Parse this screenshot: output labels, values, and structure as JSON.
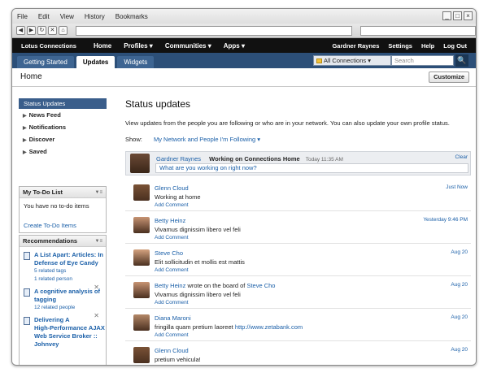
{
  "browser": {
    "menu": [
      "File",
      "Edit",
      "View",
      "History",
      "Bookmarks"
    ],
    "window_buttons": [
      "_",
      "□",
      "×"
    ],
    "nav_glyphs": [
      "◀",
      "▶",
      "↻",
      "✕",
      "⌂"
    ]
  },
  "topbar": {
    "logo": "Lotus Connections",
    "nav": [
      "Home",
      "Profiles ▾",
      "Communities ▾",
      "Apps ▾"
    ],
    "right": [
      "Gardner Raynes",
      "Settings",
      "Help",
      "Log Out"
    ]
  },
  "tabs": [
    "Getting Started",
    "Updates",
    "Widgets"
  ],
  "search": {
    "scope": "All Connections ▾",
    "placeholder": "Search",
    "button": "🔍"
  },
  "page": {
    "title": "Home",
    "customize": "Customize"
  },
  "sidebar": {
    "active": "Status Updates",
    "items": [
      "News Feed",
      "Notifications",
      "Discover",
      "Saved"
    ]
  },
  "todo": {
    "title": "My To-Do List",
    "text": "You have no to-do items",
    "link": "Create To-Do Items"
  },
  "recommendations": {
    "title": "Recommendations",
    "items": [
      {
        "title_lines": [
          "A List Apart: Articles: In",
          "Defense of Eye Candy"
        ],
        "sub_lines": [
          "5 related tags",
          "1 related person"
        ]
      },
      {
        "title_lines": [
          "A cognitive analysis of",
          "tagging"
        ],
        "sub_lines": [
          "12 related people"
        ]
      },
      {
        "title_lines": [
          "Delivering A",
          "High-Performance AJAX",
          "Web Service Broker ::",
          "Johnvey"
        ],
        "sub_lines": []
      }
    ]
  },
  "main": {
    "heading": "Status updates",
    "description": "View updates from the people you are following or who are in your network. You can also update your own profile status.",
    "show_label": "Show:",
    "show_value": "My Network and People I'm Following ▾"
  },
  "composer": {
    "name": "Gardner Raynes",
    "status": "Working on Connections Home",
    "time": "Today 11:35 AM",
    "clear": "Clear",
    "prompt": "What are you working on right now?"
  },
  "feed": [
    {
      "name": "Glenn Cloud",
      "message": "Working at home",
      "action": "Add Comment",
      "time": "Just Now"
    },
    {
      "name": "Betty Heinz",
      "message": "Vivamus dignissim libero vel feli",
      "action": "Add Comment",
      "time": "Yesterday 9:46 PM"
    },
    {
      "name": "Steve Cho",
      "message": "Elit sollicitudin et mollis est mattis",
      "action": "Add Comment",
      "time": "Aug 20"
    },
    {
      "name": "Betty Heinz",
      "connector": "wrote on the board of",
      "target": "Steve Cho",
      "message": "Vivamus dignissim libero vel feli",
      "action": "Add Comment",
      "time": "Aug 20"
    },
    {
      "name": "Diana Maroni",
      "message": "fringilla quam pretium laoreet",
      "link": "http://www.zetabank.com",
      "action": "Add Comment",
      "time": "Aug 20"
    },
    {
      "name": "Glenn Cloud",
      "message": "pretium vehicula!",
      "action": "",
      "time": "Aug 20"
    }
  ],
  "avatar_colors": [
    "#7a5236",
    "#c79473",
    "#d4a27f",
    "#c79473",
    "#b48867",
    "#7a5236"
  ]
}
